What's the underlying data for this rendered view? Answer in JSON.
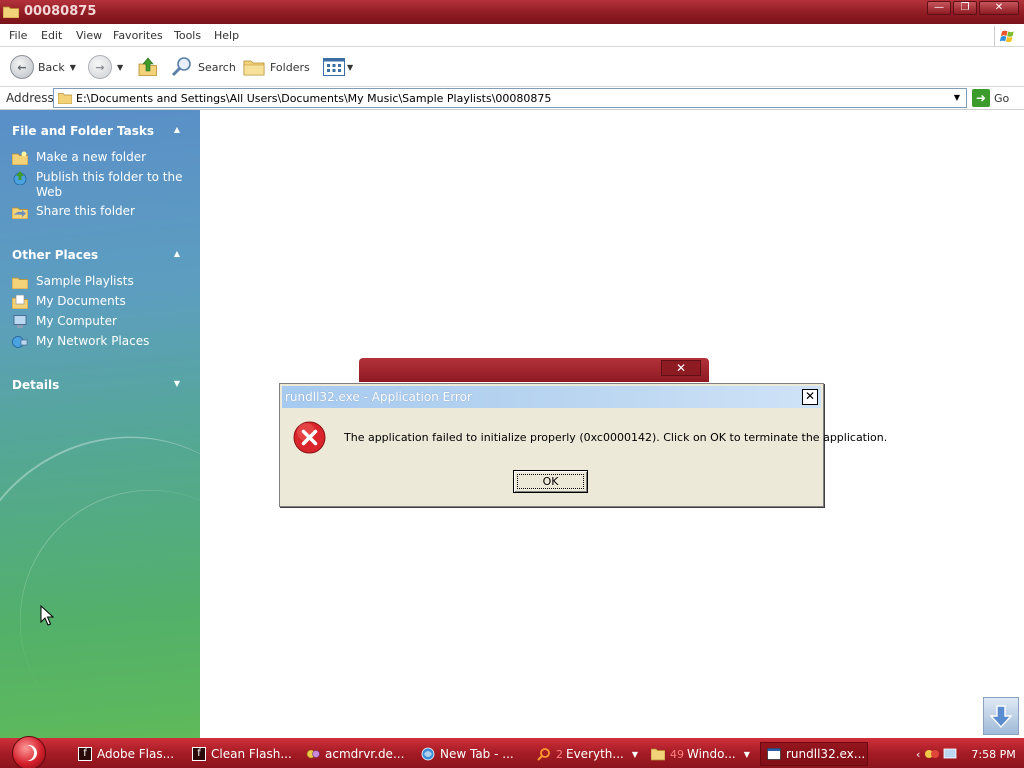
{
  "window": {
    "title": "00080875"
  },
  "menu": [
    "File",
    "Edit",
    "View",
    "Favorites",
    "Tools",
    "Help"
  ],
  "toolbar": {
    "back": "Back",
    "search": "Search",
    "folders": "Folders"
  },
  "address": {
    "label": "Address",
    "value": "E:\\Documents and Settings\\All Users\\Documents\\My Music\\Sample Playlists\\00080875",
    "go": "Go"
  },
  "sidebar": {
    "file_tasks": {
      "heading": "File and Folder Tasks",
      "items": [
        {
          "label": "Make a new folder",
          "icon": "new-folder-icon"
        },
        {
          "label": "Publish this folder to the Web",
          "icon": "publish-web-icon"
        },
        {
          "label": "Share this folder",
          "icon": "share-folder-icon"
        }
      ]
    },
    "other_places": {
      "heading": "Other Places",
      "items": [
        {
          "label": "Sample Playlists",
          "icon": "folder-icon"
        },
        {
          "label": "My Documents",
          "icon": "my-documents-icon"
        },
        {
          "label": "My Computer",
          "icon": "my-computer-icon"
        },
        {
          "label": "My Network Places",
          "icon": "network-places-icon"
        }
      ]
    },
    "details": {
      "heading": "Details"
    }
  },
  "dialog": {
    "title": "rundll32.exe - Application Error",
    "message": "The application failed to initialize properly (0xc0000142). Click on OK to terminate the application.",
    "ok": "OK",
    "icon": "error-icon"
  },
  "taskbar": {
    "items": [
      {
        "label": "Adobe Flas...",
        "icon": "flash-icon"
      },
      {
        "label": "Clean Flash...",
        "icon": "flash-icon"
      },
      {
        "label": "acmdrvr.de...",
        "icon": "driver-icon"
      },
      {
        "label": "New Tab - ...",
        "icon": "browser-icon"
      },
      {
        "count": "2",
        "label": "Everyth...",
        "icon": "search-icon"
      },
      {
        "count": "49",
        "label": "Windo...",
        "icon": "folder-icon"
      },
      {
        "label": "rundll32.ex...",
        "icon": "window-icon"
      }
    ],
    "clock": "7:58 PM"
  },
  "colors": {
    "title_bar": "#8e1a22",
    "taskbar": "#a51c25",
    "dialog_title": "#b8d4f0",
    "dialog_bg": "#ece9d8",
    "sidebar_top": "#5a8fc8",
    "sidebar_bottom": "#5fba5a"
  }
}
